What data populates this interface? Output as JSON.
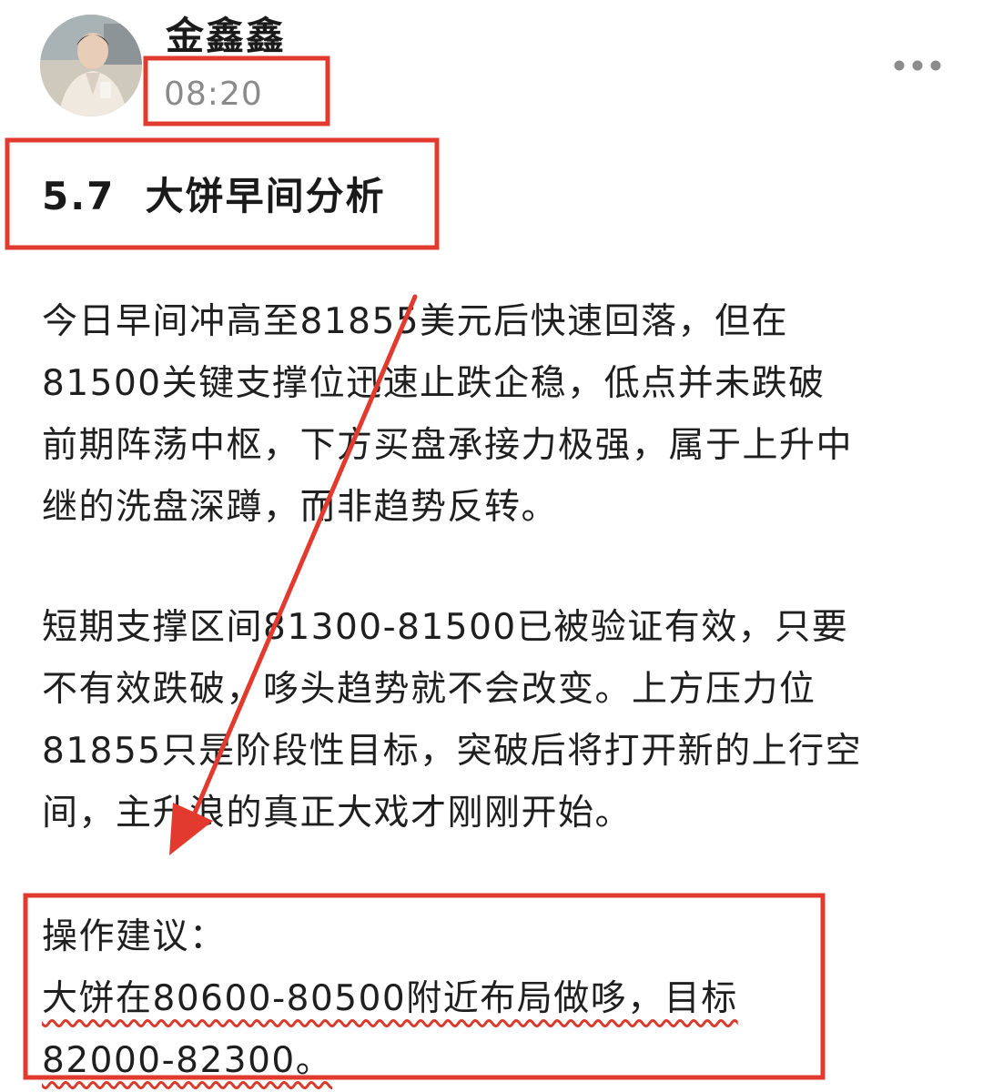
{
  "post": {
    "author_name": "金鑫鑫",
    "time": "08:20",
    "title": "5.7  大饼早间分析",
    "paragraph1": [
      "今日早间冲高至81855美元后快速回落，但在",
      "81500关键支撑位迅速止跌企稳，低点并未跌破",
      "前期阵荡中枢，下方买盘承接力极强，属于上升中",
      "继的洗盘深蹲，而非趋势反转。"
    ],
    "paragraph2": [
      "短期支撑区间81300-81500已被验证有效，只要",
      "不有效跌破，哆头趋势就不会改变。上方压力位",
      "81855只是阶段性目标，突破后将打开新的上行空",
      "间，主升浪的真正大戏才刚刚开始。"
    ],
    "operation": {
      "heading": "操作建议：",
      "line1": "大饼在80600-80500附近布局做哆，目标",
      "line2": "82000-82300。"
    }
  },
  "icons": {
    "menu": "more-horizontal-icon",
    "avatar": "avatar-photo"
  },
  "colors": {
    "annotation_red": "#e23a2e",
    "text": "#1f1f1f",
    "time": "#8a8a8a"
  }
}
